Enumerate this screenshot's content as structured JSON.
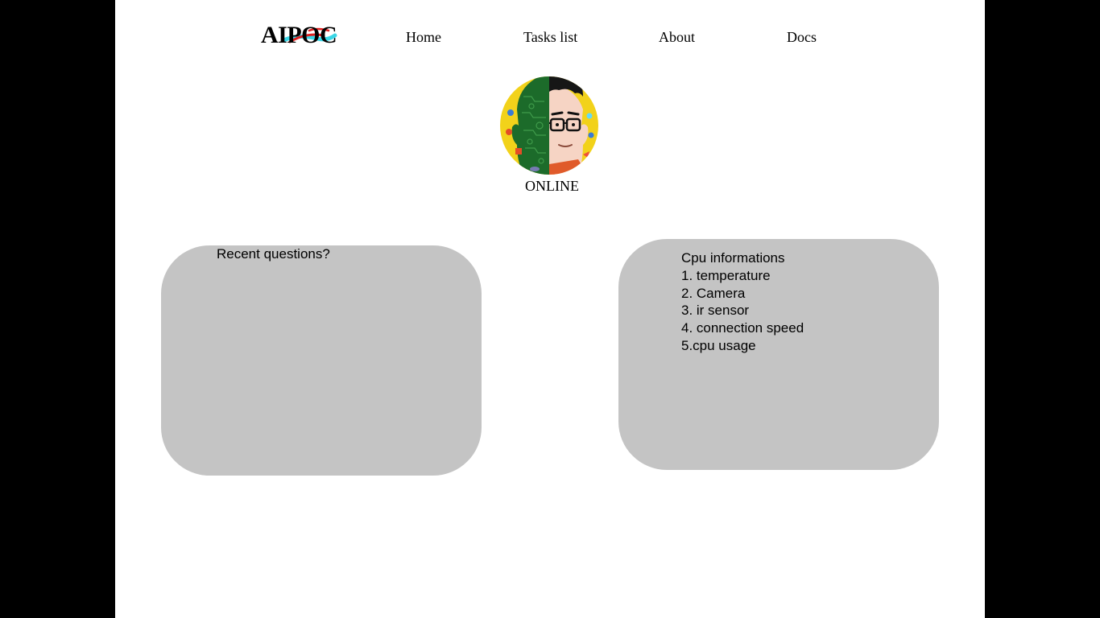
{
  "app": {
    "logo_text": "AIPOC"
  },
  "nav": {
    "items": [
      {
        "label": "Home"
      },
      {
        "label": "Tasks list"
      },
      {
        "label": "About"
      },
      {
        "label": "Docs"
      }
    ]
  },
  "profile": {
    "status": "ONLINE"
  },
  "cards": {
    "recent": {
      "title": "Recent questions?"
    },
    "cpu": {
      "title": "Cpu informations",
      "items": [
        "1. temperature",
        "2. Camera",
        "3. ir sensor",
        "4. connection speed",
        "5.cpu usage"
      ]
    }
  },
  "colors": {
    "page_background": "#ffffff",
    "outer_background": "#000000",
    "card_background": "#c4c4c4",
    "logo_accent_red": "#e02020",
    "logo_accent_cyan": "#3ad6e6"
  }
}
